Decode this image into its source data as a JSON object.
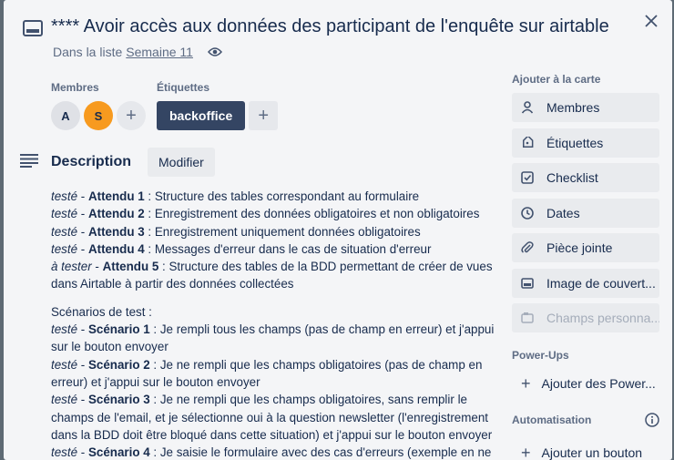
{
  "card": {
    "title": "**** Avoir accès aux données des participant de l'enquête sur airtable",
    "list_prefix": "Dans la liste",
    "list_name": "Semaine 11"
  },
  "members": {
    "label": "Membres",
    "avatars": [
      "A",
      "S"
    ],
    "add": "+"
  },
  "labels": {
    "label": "Étiquettes",
    "items": [
      "backoffice"
    ],
    "add": "+"
  },
  "description": {
    "title": "Description",
    "edit_label": "Modifier",
    "lines": [
      {
        "status": "testé",
        "sep": " - ",
        "key": "Attendu 1",
        "text": " : Structure des tables correspondant au formulaire"
      },
      {
        "status": "testé",
        "sep": " - ",
        "key": "Attendu 2",
        "text": " : Enregistrement des données obligatoires et non obligatoires"
      },
      {
        "status": "testé",
        "sep": " - ",
        "key": "Attendu 3",
        "text": " : Enregistrement uniquement données obligatoires"
      },
      {
        "status": "testé",
        "sep": " - ",
        "key": "Attendu 4",
        "text": " : Messages d'erreur dans le cas de situation d'erreur"
      },
      {
        "status": "à tester",
        "sep": " - ",
        "key": "Attendu 5",
        "text": " : Structure des tables de la BDD permettant de créer de vues dans Airtable à partir des données collectées"
      }
    ],
    "scenarios_title": "Scénarios de test :",
    "scenarios": [
      {
        "status": "testé",
        "sep": " - ",
        "key": "Scénario 1",
        "text": " : Je rempli tous les champs (pas de champ en erreur) et j'appui sur le bouton envoyer"
      },
      {
        "status": "testé",
        "sep": " - ",
        "key": "Scénario 2",
        "text": " : Je ne rempli que les champs obligatoires (pas de champ en erreur) et j'appui sur le bouton envoyer"
      },
      {
        "status": "testé",
        "sep": " - ",
        "key": "Scénario 3",
        "text": " : Je ne rempli que les champs obligatoires, sans remplir le champs de l'email, et je sélectionne oui à la question newsletter (l'enregistrement dans la BDD doit être bloqué dans cette situation) et j'appui sur le bouton envoyer"
      },
      {
        "status": "testé",
        "sep": " - ",
        "key": "Scénario 4",
        "text": " : Je saisie le formulaire avec des cas d'erreurs (exemple en ne"
      }
    ]
  },
  "sidebar": {
    "add_to_card_title": "Ajouter à la carte",
    "buttons": [
      {
        "label": "Membres",
        "icon": "person-icon"
      },
      {
        "label": "Étiquettes",
        "icon": "tag-icon"
      },
      {
        "label": "Checklist",
        "icon": "checklist-icon"
      },
      {
        "label": "Dates",
        "icon": "clock-icon"
      },
      {
        "label": "Pièce jointe",
        "icon": "paperclip-icon"
      },
      {
        "label": "Image de couvert...",
        "icon": "cover-icon"
      },
      {
        "label": "Champs personna...",
        "icon": "custom-fields-icon"
      }
    ],
    "powerups_title": "Power-Ups",
    "add_powerups": "Ajouter des Power...",
    "automation_title": "Automatisation",
    "add_button": "Ajouter un bouton"
  },
  "colors": {
    "label_dark": "#344563",
    "avatar_s": "#f79a1f",
    "backdrop": "#5e6a74"
  }
}
